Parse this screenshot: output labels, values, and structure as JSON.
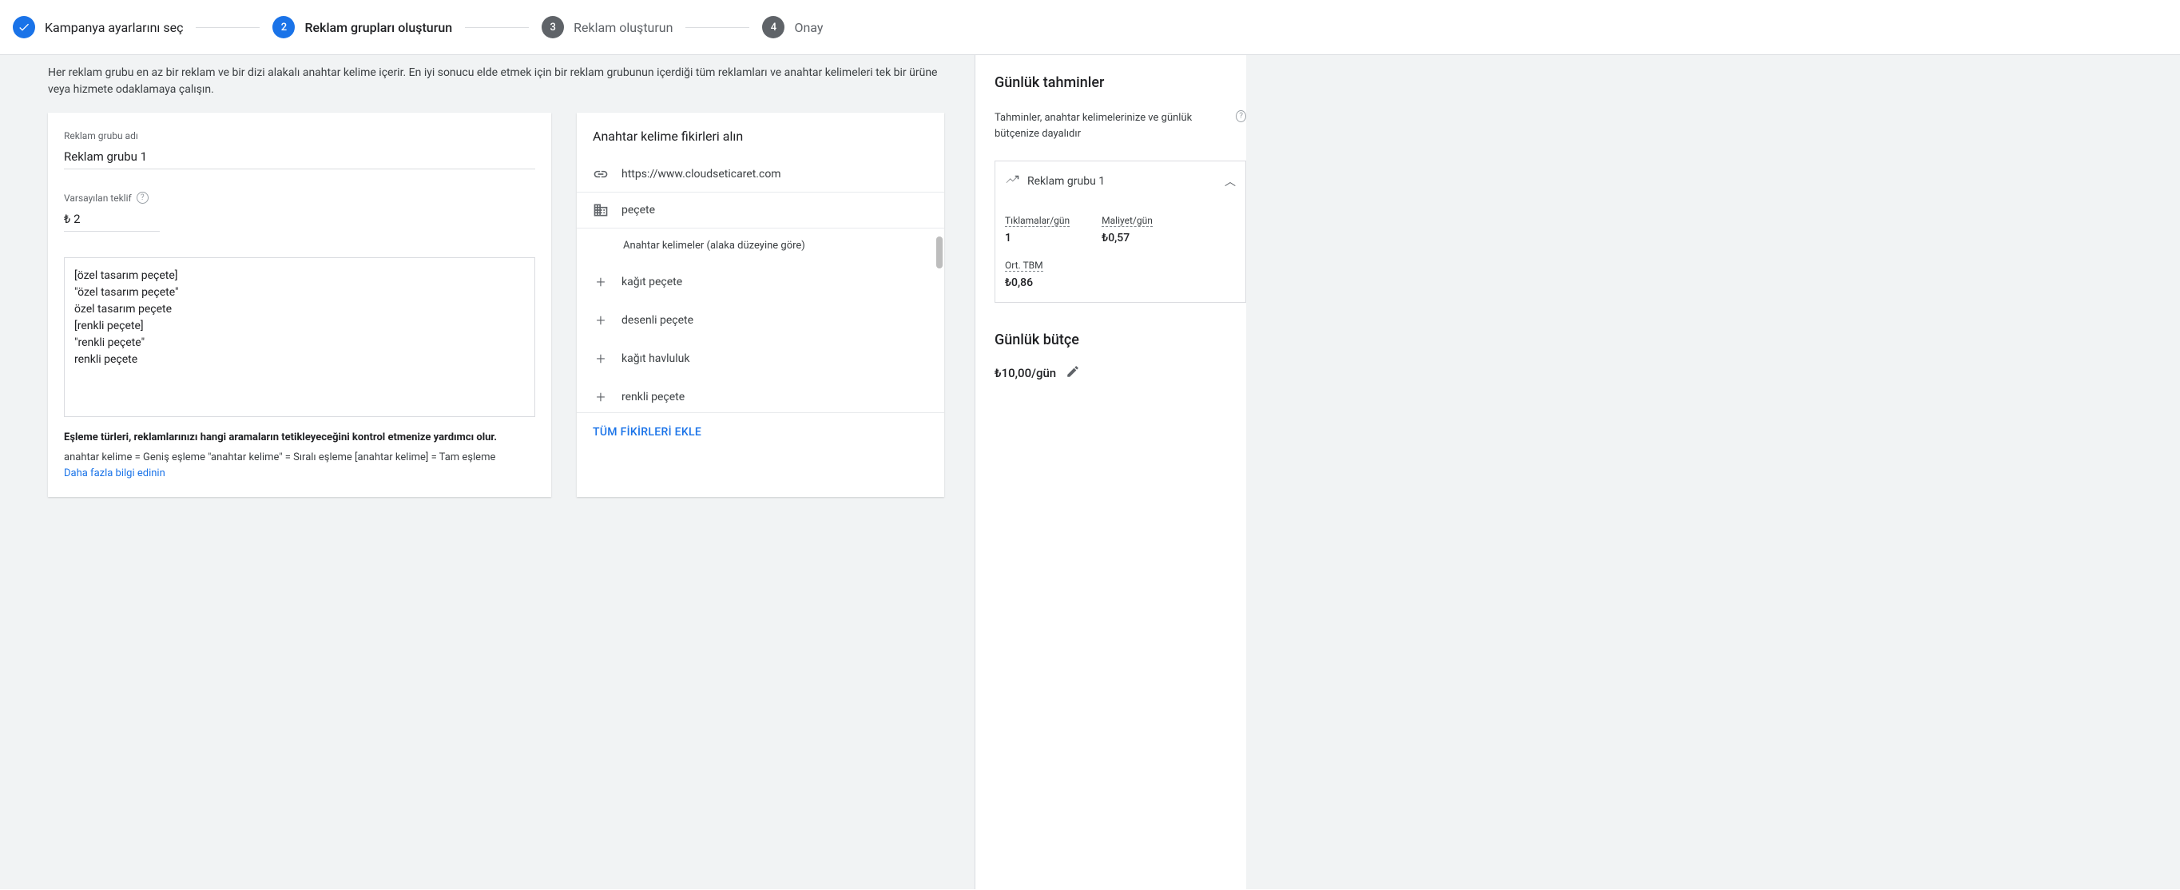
{
  "stepper": {
    "steps": [
      {
        "label": "Kampanya ayarlarını seç",
        "state": "done",
        "num": ""
      },
      {
        "label": "Reklam grupları oluşturun",
        "state": "active",
        "num": "2"
      },
      {
        "label": "Reklam oluşturun",
        "state": "pending",
        "num": "3"
      },
      {
        "label": "Onay",
        "state": "pending",
        "num": "4"
      }
    ]
  },
  "intro": "Her reklam grubu en az bir reklam ve bir dizi alakalı anahtar kelime içerir. En iyi sonucu elde etmek için bir reklam grubunun içerdiği tüm reklamları ve anahtar kelimeleri tek bir ürüne veya hizmete odaklamaya çalışın.",
  "adgroup": {
    "name_label": "Reklam grubu adı",
    "name_value": "Reklam grubu 1",
    "bid_label": "Varsayılan teklif",
    "bid_value": "₺ 2",
    "keywords": "[özel tasarım peçete]\n\"özel tasarım peçete\"\nözel tasarım peçete\n[renkli peçete]\n\"renkli peçete\"\nrenkli peçete",
    "match_title": "Eşleme türleri, reklamlarınızı hangi aramaların tetikleyeceğini kontrol etmenize yardımcı olur.",
    "match_examples": "anahtar kelime = Geniş eşleme   \"anahtar kelime\" = Sıralı eşleme   [anahtar kelime] = Tam eşleme",
    "learn_more": "Daha fazla bilgi edinin"
  },
  "ideas": {
    "title": "Anahtar kelime fikirleri alın",
    "url": "https://www.cloudseticaret.com",
    "product": "peçete",
    "relevance_header": "Anahtar kelimeler (alaka düzeyine göre)",
    "suggestions": [
      "kağıt peçete",
      "desenli peçete",
      "kağıt havluluk",
      "renkli peçete"
    ],
    "add_all": "TÜM FİKİRLERİ EKLE"
  },
  "estimates": {
    "title": "Günlük tahminler",
    "desc": "Tahminler, anahtar kelimelerinize ve günlük bütçenize dayalıdır",
    "group_name": "Reklam grubu 1",
    "metrics": {
      "clicks_label": "Tıklamalar/gün",
      "clicks_value": "1",
      "cost_label": "Maliyet/gün",
      "cost_value": "₺0,57",
      "cpc_label": "Ort. TBM",
      "cpc_value": "₺0,86"
    },
    "budget_title": "Günlük bütçe",
    "budget_value": "₺10,00/gün"
  }
}
